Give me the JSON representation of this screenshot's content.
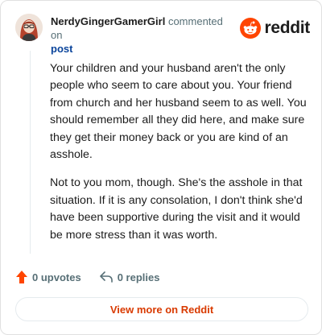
{
  "header": {
    "author": "NerdyGingerGamerGirl",
    "action_text": "commented on",
    "post_link": "post",
    "brand_name": "reddit"
  },
  "comment": {
    "paragraphs": [
      "Your children and your husband aren't the only people who seem to care about you. Your friend from church and her husband seem to as well. You should remember all they did here, and make sure they get their money back or you are kind of an asshole.",
      "Not to you mom, though. She's the asshole in that situation. If it is any consolation, I don't think she'd have been supportive during the visit and it would be more stress than it was worth."
    ]
  },
  "actions": {
    "upvotes_label": "0 upvotes",
    "replies_label": "0 replies"
  },
  "footer": {
    "view_more_label": "View more on Reddit"
  },
  "icons": {
    "upvote": "upvote-arrow-icon",
    "reply": "reply-arrow-icon",
    "brand": "reddit-snoo-icon",
    "avatar": "user-avatar"
  },
  "colors": {
    "brand_orange": "#ff4500",
    "link_blue": "#0a449b",
    "view_more_text": "#d93a00",
    "muted_text": "#576f76"
  }
}
